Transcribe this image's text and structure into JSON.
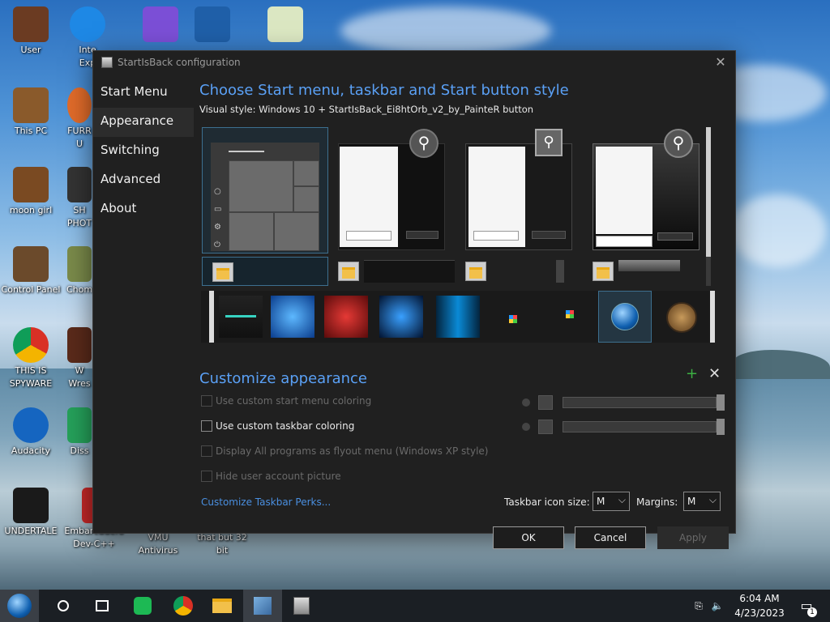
{
  "desktop": {
    "icons": [
      {
        "label": "User",
        "color": "#6b3b22"
      },
      {
        "label": "Inte\nExp",
        "color": "#1e88e5"
      },
      {
        "label": "",
        "color": "#7b4fd6"
      },
      {
        "label": "",
        "color": "#1f5fa8"
      },
      {
        "label": "",
        "color": "#dbe7c2"
      },
      {
        "label": "This PC",
        "color": "#8a5a2b"
      },
      {
        "label": "FURR\nU",
        "color": "#e06b2a"
      },
      {
        "label": "moon girl",
        "color": "#7a4a22"
      },
      {
        "label": "SH\nPHOT",
        "color": "#333333"
      },
      {
        "label": "Control Panel",
        "color": "#6b4a2b"
      },
      {
        "label": "Chom",
        "color": "#7a8a4a"
      },
      {
        "label": "THIS IS\nSPYWARE",
        "color": "#d93025"
      },
      {
        "label": "W\nWres",
        "color": "#5a2a1a"
      },
      {
        "label": "Audacity",
        "color": "#1565c0"
      },
      {
        "label": "Diss",
        "color": "#25a05a"
      },
      {
        "label": "UNDERTALE",
        "color": "#1a1a1a"
      },
      {
        "label": "Embarcadero\nDev-C++",
        "color": "#c62828"
      },
      {
        "label": "VMU\nAntivirus",
        "color": ""
      },
      {
        "label": "that but 32\nbit",
        "color": ""
      }
    ]
  },
  "dialog": {
    "title": "StartIsBack configuration",
    "sidebar": [
      "Start Menu",
      "Appearance",
      "Switching",
      "Advanced",
      "About"
    ],
    "active_tab": "Appearance",
    "heading": "Choose Start menu, taskbar and Start button style",
    "visual_style_label": "Visual style:",
    "visual_style_value": "Windows 10 + StartIsBack_Ei8htOrb_v2_by_PainteR button",
    "customize_heading": "Customize appearance",
    "options": [
      {
        "label": "Use custom start menu coloring",
        "enabled": false,
        "checked": false
      },
      {
        "label": "Use custom taskbar coloring",
        "enabled": true,
        "checked": false
      },
      {
        "label": "Display All programs as flyout menu (Windows XP style)",
        "enabled": false,
        "checked": false
      },
      {
        "label": "Hide user account picture",
        "enabled": false,
        "checked": false
      }
    ],
    "link": "Customize Taskbar Perks...",
    "icon_size_label": "Taskbar icon size:",
    "icon_size_value": "M",
    "margins_label": "Margins:",
    "margins_value": "M",
    "buttons": {
      "ok": "OK",
      "cancel": "Cancel",
      "apply": "Apply"
    }
  },
  "taskbar": {
    "clock_time": "6:04 AM",
    "clock_date": "4/23/2023",
    "notification_count": "1"
  }
}
